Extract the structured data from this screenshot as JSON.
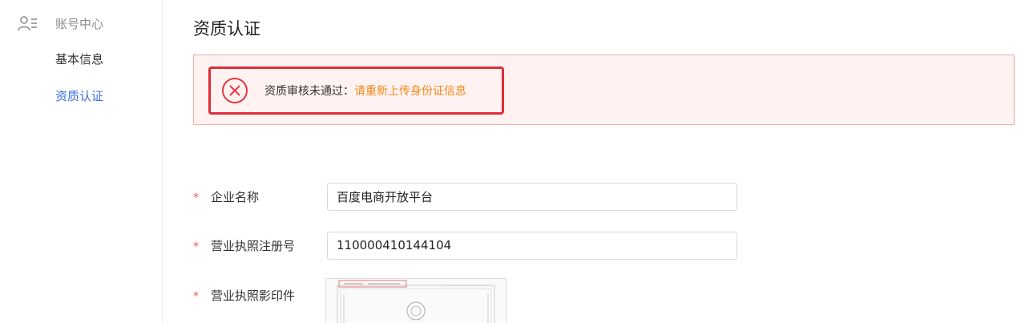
{
  "sidebar": {
    "section_label": "账号中心",
    "section_icon": "user-list-icon",
    "items": [
      {
        "label": "基本信息",
        "active": false
      },
      {
        "label": "资质认证",
        "active": true
      }
    ]
  },
  "main": {
    "title": "资质认证",
    "alert": {
      "icon": "error-circle-icon",
      "message": "资质审核未通过：",
      "action_text": "请重新上传身份证信息"
    },
    "form": {
      "fields": [
        {
          "label": "企业名称",
          "required": true,
          "value": "百度电商开放平台"
        },
        {
          "label": "营业执照注册号",
          "required": true,
          "value": "110000410144104"
        },
        {
          "label": "营业执照影印件",
          "required": true
        }
      ]
    }
  },
  "colors": {
    "accent": "#3b6fe0",
    "error": "#e02b3a",
    "warning_link": "#f08a1c",
    "alert_bg": "#fff2f0"
  }
}
